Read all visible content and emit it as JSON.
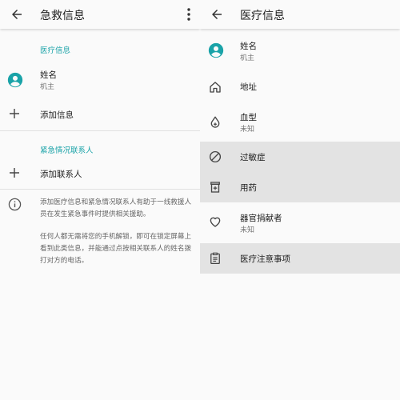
{
  "left": {
    "title": "急救信息",
    "section_medical": "医疗信息",
    "owner_name_label": "姓名",
    "owner_name_value": "机主",
    "add_info_label": "添加信息",
    "section_contacts": "紧急情况联系人",
    "add_contact_label": "添加联系人",
    "info_para1": "添加医疗信息和紧急情况联系人有助于一线救援人员在发生紧急事件时提供相关援助。",
    "info_para2": "任何人都无需将您的手机解锁，即可在锁定屏幕上看到此类信息，并能通过点按相关联系人的姓名拨打对方的电话。"
  },
  "right": {
    "title": "医疗信息",
    "items": [
      {
        "label": "姓名",
        "value": "机主",
        "icon": "account-circle-icon"
      },
      {
        "label": "地址",
        "value": "",
        "icon": "home-icon"
      },
      {
        "label": "血型",
        "value": "未知",
        "icon": "blood-drop-icon"
      },
      {
        "label": "过敏症",
        "value": "",
        "icon": "block-icon"
      },
      {
        "label": "用药",
        "value": "",
        "icon": "medication-icon"
      },
      {
        "label": "器官捐献者",
        "value": "未知",
        "icon": "heart-outline-icon"
      },
      {
        "label": "医疗注意事项",
        "value": "",
        "icon": "clipboard-icon"
      }
    ]
  },
  "colors": {
    "accent": "#1aa3a8",
    "highlight": "#e3e3e3",
    "background": "#fafafa"
  }
}
